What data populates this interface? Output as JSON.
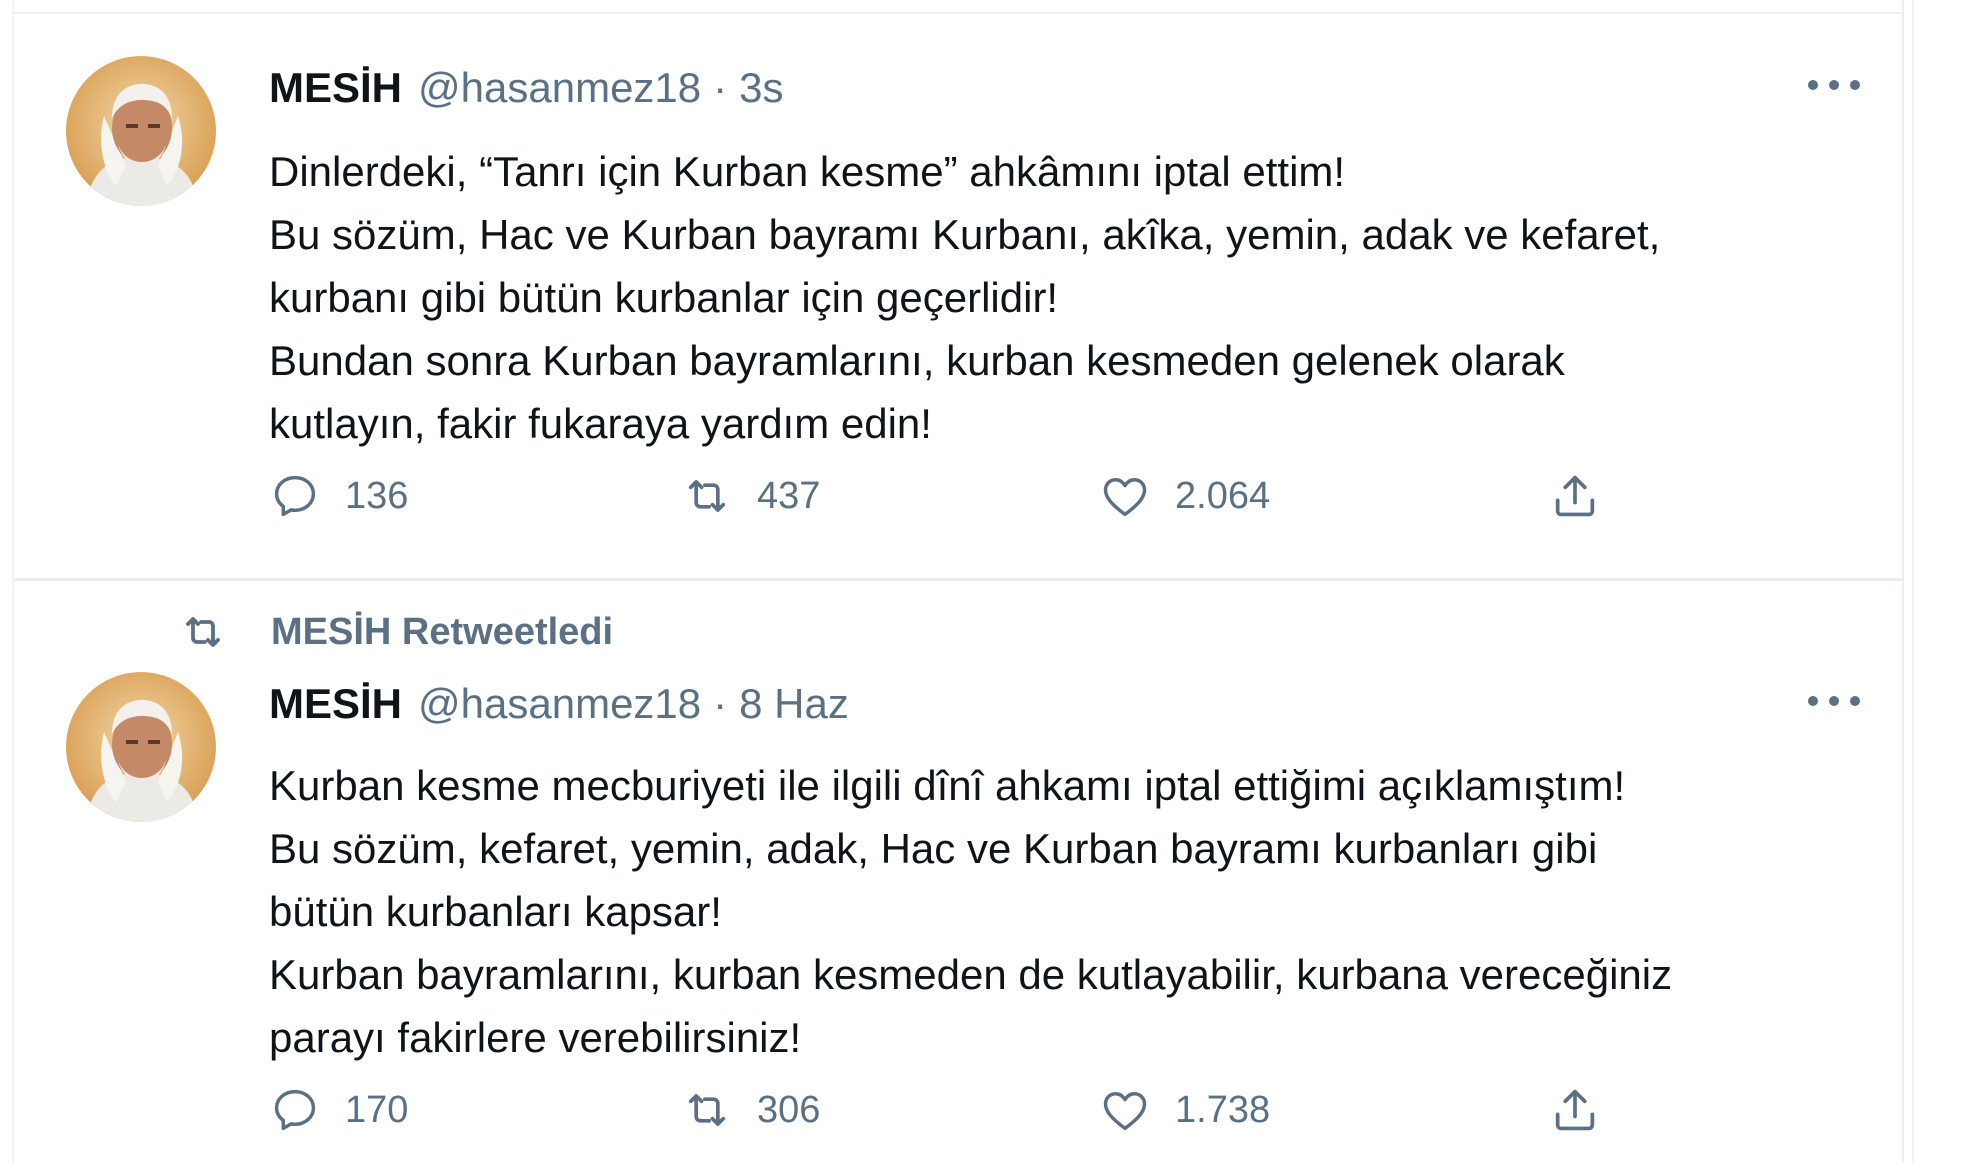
{
  "tweets": [
    {
      "author": {
        "name": "MESİH",
        "handle": "@hasanmez18",
        "avatar_icon": "profile-photo-avatar"
      },
      "separator": "·",
      "time": "3s",
      "lines": [
        "Dinlerdeki, “Tanrı için Kurban kesme” ahkâmını iptal ettim!",
        "Bu sözüm, Hac ve Kurban bayramı Kurbanı, akîka, yemin, adak ve kefaret,",
        "kurbanı gibi bütün kurbanlar için geçerlidir!",
        "Bundan sonra Kurban bayramlarını, kurban kesmeden gelenek olarak",
        "kutlayın, fakir fukaraya yardım edin!"
      ],
      "stats": {
        "replies": "136",
        "retweets": "437",
        "likes": "2.064"
      }
    },
    {
      "retweet_label": "MESİH Retweetledi",
      "author": {
        "name": "MESİH",
        "handle": "@hasanmez18",
        "avatar_icon": "profile-photo-avatar"
      },
      "separator": "·",
      "time": "8 Haz",
      "lines": [
        "Kurban kesme mecburiyeti ile ilgili dînî ahkamı iptal ettiğimi açıklamıştım!",
        "Bu sözüm, kefaret, yemin, adak, Hac ve Kurban bayramı kurbanları gibi",
        "bütün kurbanları kapsar!",
        "Kurban bayramlarını, kurban kesmeden de kutlayabilir, kurbana vereceğiniz",
        "parayı fakirlere verebilirsiniz!"
      ],
      "stats": {
        "replies": "170",
        "retweets": "306",
        "likes": "1.738"
      }
    }
  ],
  "icons": {
    "reply": "reply-icon",
    "retweet": "retweet-icon",
    "like": "heart-icon",
    "share": "share-icon",
    "more": "more-icon"
  },
  "colors": {
    "text_primary": "#0f1419",
    "text_secondary": "#5b7083",
    "divider": "#ebeef0"
  }
}
